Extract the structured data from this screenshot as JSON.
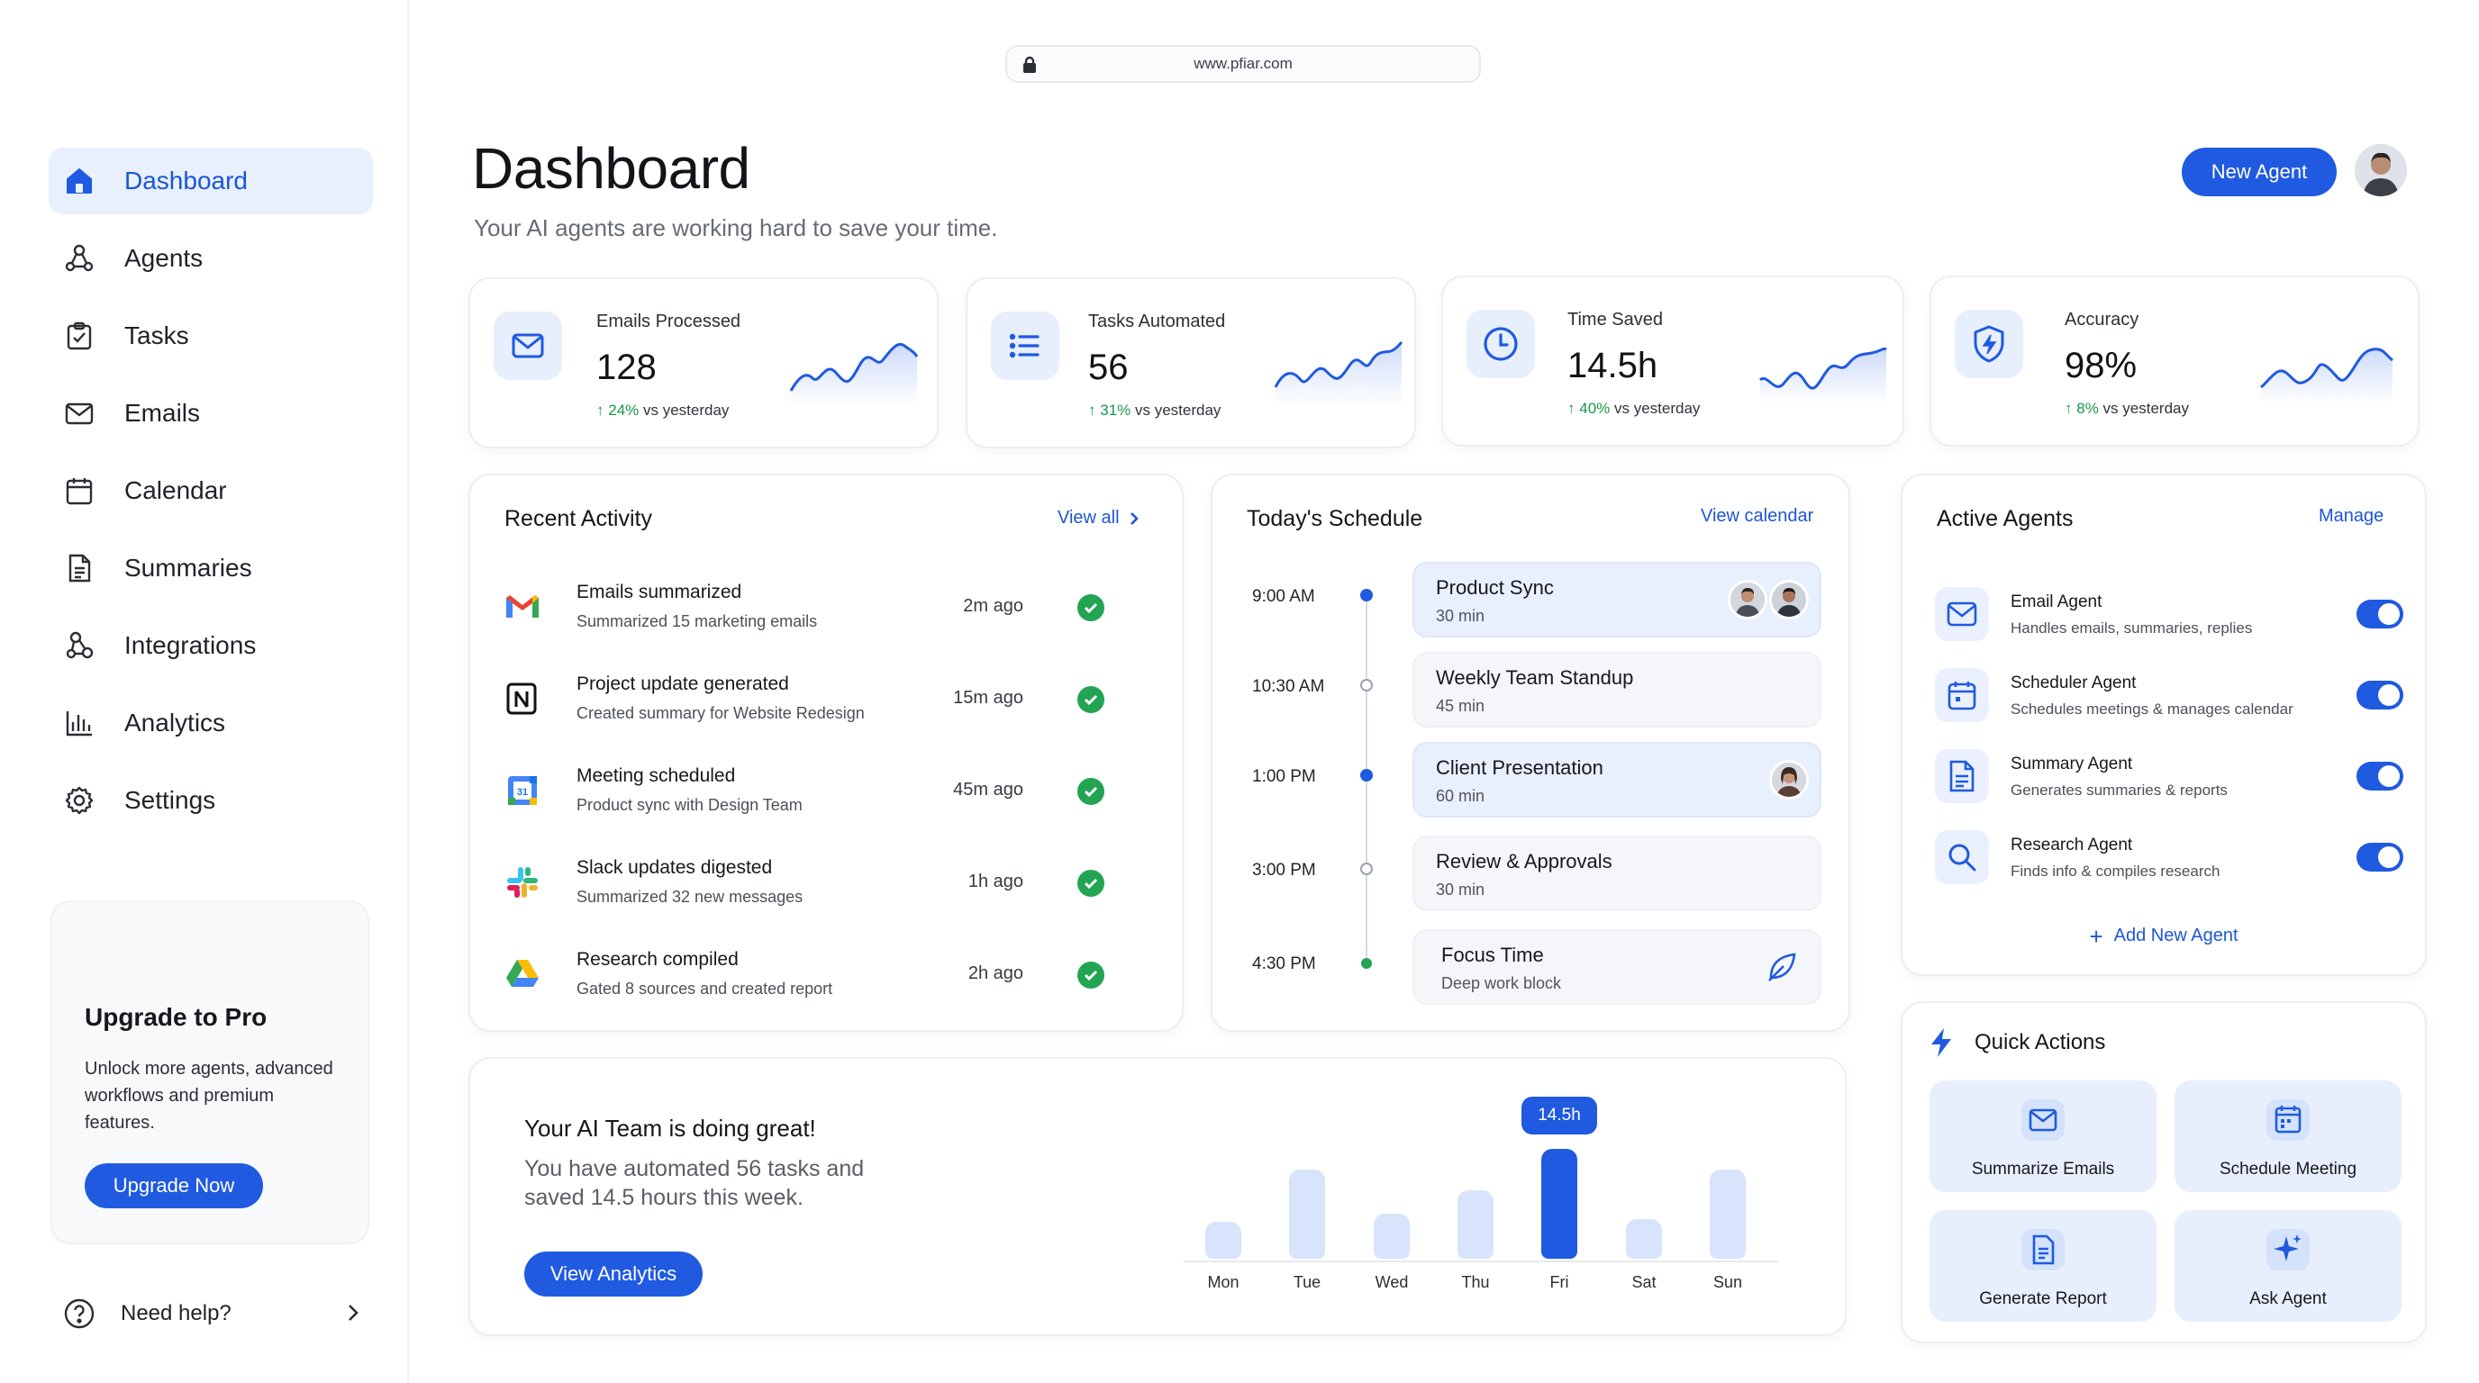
{
  "browser": {
    "url": "www.pfiar.com"
  },
  "sidebar": {
    "items": [
      {
        "label": "Dashboard",
        "icon": "home-icon",
        "active": true
      },
      {
        "label": "Agents",
        "icon": "agents-icon"
      },
      {
        "label": "Tasks",
        "icon": "clipboard-check-icon"
      },
      {
        "label": "Emails",
        "icon": "mail-icon"
      },
      {
        "label": "Calendar",
        "icon": "calendar-icon"
      },
      {
        "label": "Summaries",
        "icon": "document-icon"
      },
      {
        "label": "Integrations",
        "icon": "integrations-icon"
      },
      {
        "label": "Analytics",
        "icon": "bar-chart-icon"
      },
      {
        "label": "Settings",
        "icon": "gear-icon"
      }
    ],
    "upgrade": {
      "title": "Upgrade to Pro",
      "text": "Unlock more agents, advanced workflows and premium features.",
      "button": "Upgrade Now"
    },
    "help": "Need help?"
  },
  "header": {
    "title": "Dashboard",
    "subtitle": "Your AI agents are working hard to save your time.",
    "new_agent": "New Agent"
  },
  "stats": [
    {
      "label": "Emails Processed",
      "value": "128",
      "delta": "24%",
      "delta_suffix": "vs yesterday",
      "icon": "mail-icon"
    },
    {
      "label": "Tasks Automated",
      "value": "56",
      "delta": "31%",
      "delta_suffix": "vs yesterday",
      "icon": "list-icon"
    },
    {
      "label": "Time Saved",
      "value": "14.5h",
      "delta": "40%",
      "delta_suffix": "vs yesterday",
      "icon": "clock-icon"
    },
    {
      "label": "Accuracy",
      "value": "98%",
      "delta": "8%",
      "delta_suffix": "vs yesterday",
      "icon": "shield-bolt-icon"
    }
  ],
  "activity": {
    "title": "Recent Activity",
    "link": "View all",
    "items": [
      {
        "title": "Emails summarized",
        "desc": "Summarized 15 marketing emails",
        "time": "2m ago",
        "logo": "gmail-logo"
      },
      {
        "title": "Project update generated",
        "desc": "Created summary for Website Redesign",
        "time": "15m ago",
        "logo": "notion-logo"
      },
      {
        "title": "Meeting scheduled",
        "desc": "Product sync with Design Team",
        "time": "45m ago",
        "logo": "google-calendar-logo"
      },
      {
        "title": "Slack updates digested",
        "desc": "Summarized 32 new messages",
        "time": "1h ago",
        "logo": "slack-logo"
      },
      {
        "title": "Research compiled",
        "desc": "Gated 8 sources and created report",
        "time": "2h ago",
        "logo": "google-drive-logo"
      }
    ]
  },
  "schedule": {
    "title": "Today's Schedule",
    "link": "View calendar",
    "items": [
      {
        "time": "9:00 AM",
        "name": "Product Sync",
        "duration": "30 min"
      },
      {
        "time": "10:30 AM",
        "name": "Weekly Team Standup",
        "duration": "45 min"
      },
      {
        "time": "1:00 PM",
        "name": "Client Presentation",
        "duration": "60 min"
      },
      {
        "time": "3:00 PM",
        "name": "Review & Approvals",
        "duration": "30 min"
      },
      {
        "time": "4:30 PM",
        "name": "Focus Time",
        "duration": "Deep work block"
      }
    ]
  },
  "agents": {
    "title": "Active Agents",
    "link": "Manage",
    "items": [
      {
        "name": "Email Agent",
        "desc": "Handles emails, summaries, replies",
        "enabled": true,
        "icon": "mail-icon"
      },
      {
        "name": "Scheduler Agent",
        "desc": "Schedules meetings & manages calendar",
        "enabled": true,
        "icon": "calendar-icon"
      },
      {
        "name": "Summary Agent",
        "desc": "Generates summaries & reports",
        "enabled": true,
        "icon": "document-icon"
      },
      {
        "name": "Research Agent",
        "desc": "Finds info & compiles research",
        "enabled": true,
        "icon": "search-icon"
      }
    ],
    "add": "Add New Agent"
  },
  "quick_actions": {
    "title": "Quick Actions",
    "items": [
      {
        "label": "Summarize Emails",
        "icon": "mail-icon"
      },
      {
        "label": "Schedule Meeting",
        "icon": "calendar-icon"
      },
      {
        "label": "Generate Report",
        "icon": "document-icon"
      },
      {
        "label": "Ask Agent",
        "icon": "sparkle-icon"
      }
    ]
  },
  "team": {
    "title": "Your AI Team is doing great!",
    "text": "You have automated 56 tasks and saved 14.5 hours this week.",
    "button": "View Analytics"
  },
  "chart_data": {
    "type": "bar",
    "categories": [
      "Mon",
      "Tue",
      "Wed",
      "Thu",
      "Fri",
      "Sat",
      "Sun"
    ],
    "values": [
      3.8,
      9.2,
      4.6,
      7.0,
      11.3,
      4.1,
      9.2
    ],
    "highlight": "Fri",
    "highlight_label": "14.5h",
    "colors": {
      "bar": "#d7e4fc",
      "highlight": "#1f5ae0"
    }
  },
  "colors": {
    "accent": "#1f5ae0",
    "success": "#22a453",
    "tile": "#e7effd"
  }
}
